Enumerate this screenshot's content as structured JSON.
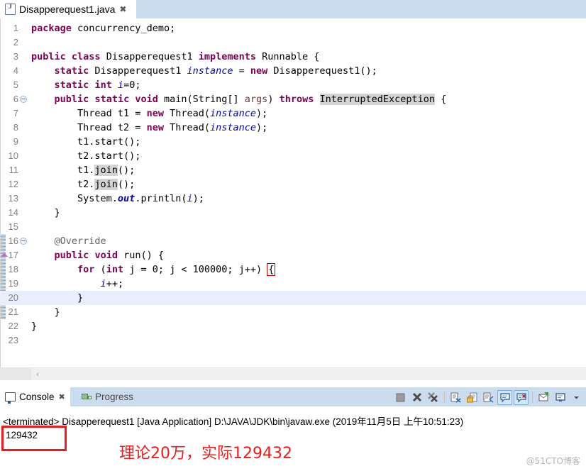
{
  "editor_tab": {
    "label": "Disapperequest1.java",
    "icon": "java-file-icon",
    "close": "✖"
  },
  "code": {
    "lines": [
      {
        "no": "1",
        "indent": 0,
        "tokens": [
          {
            "t": "package",
            "c": "kw"
          },
          {
            "t": " concurrency_demo;",
            "c": ""
          }
        ]
      },
      {
        "no": "2",
        "indent": 0,
        "tokens": []
      },
      {
        "no": "3",
        "indent": 0,
        "tokens": [
          {
            "t": "public",
            "c": "kw"
          },
          {
            "t": " ",
            "c": ""
          },
          {
            "t": "class",
            "c": "kw"
          },
          {
            "t": " Disapperequest1 ",
            "c": ""
          },
          {
            "t": "implements",
            "c": "kw"
          },
          {
            "t": " Runnable {",
            "c": ""
          }
        ]
      },
      {
        "no": "4",
        "indent": 0,
        "tokens": [
          {
            "t": "    ",
            "c": ""
          },
          {
            "t": "static",
            "c": "kw"
          },
          {
            "t": " Disapperequest1 ",
            "c": ""
          },
          {
            "t": "instance",
            "c": "fld"
          },
          {
            "t": " = ",
            "c": ""
          },
          {
            "t": "new",
            "c": "kw"
          },
          {
            "t": " Disapperequest1();",
            "c": ""
          }
        ]
      },
      {
        "no": "5",
        "indent": 0,
        "tokens": [
          {
            "t": "    ",
            "c": ""
          },
          {
            "t": "static",
            "c": "kw"
          },
          {
            "t": " ",
            "c": ""
          },
          {
            "t": "int",
            "c": "kw"
          },
          {
            "t": " ",
            "c": ""
          },
          {
            "t": "i",
            "c": "fld"
          },
          {
            "t": "=0;",
            "c": ""
          }
        ]
      },
      {
        "no": "6",
        "indent": 0,
        "fold": true,
        "tokens": [
          {
            "t": "    ",
            "c": ""
          },
          {
            "t": "public",
            "c": "kw"
          },
          {
            "t": " ",
            "c": ""
          },
          {
            "t": "static",
            "c": "kw"
          },
          {
            "t": " ",
            "c": ""
          },
          {
            "t": "void",
            "c": "kw"
          },
          {
            "t": " main(String[] ",
            "c": ""
          },
          {
            "t": "args",
            "c": "param"
          },
          {
            "t": ") ",
            "c": ""
          },
          {
            "t": "throws",
            "c": "kw"
          },
          {
            "t": " ",
            "c": ""
          },
          {
            "t": "InterruptedException",
            "c": "occ"
          },
          {
            "t": " {",
            "c": ""
          }
        ]
      },
      {
        "no": "7",
        "indent": 0,
        "tokens": [
          {
            "t": "        Thread t1 = ",
            "c": ""
          },
          {
            "t": "new",
            "c": "kw"
          },
          {
            "t": " Thread(",
            "c": ""
          },
          {
            "t": "instance",
            "c": "fld"
          },
          {
            "t": ");",
            "c": ""
          }
        ]
      },
      {
        "no": "8",
        "indent": 0,
        "tokens": [
          {
            "t": "        Thread t2 = ",
            "c": ""
          },
          {
            "t": "new",
            "c": "kw"
          },
          {
            "t": " Thread(",
            "c": ""
          },
          {
            "t": "instance",
            "c": "fld"
          },
          {
            "t": ");",
            "c": ""
          }
        ]
      },
      {
        "no": "9",
        "indent": 0,
        "tokens": [
          {
            "t": "        t1.start();",
            "c": ""
          }
        ]
      },
      {
        "no": "10",
        "indent": 0,
        "tokens": [
          {
            "t": "        t2.start();",
            "c": ""
          }
        ]
      },
      {
        "no": "11",
        "indent": 0,
        "tokens": [
          {
            "t": "        t1.",
            "c": ""
          },
          {
            "t": "join",
            "c": "occ"
          },
          {
            "t": "();",
            "c": ""
          }
        ]
      },
      {
        "no": "12",
        "indent": 0,
        "tokens": [
          {
            "t": "        t2.",
            "c": ""
          },
          {
            "t": "join",
            "c": "occ"
          },
          {
            "t": "();",
            "c": ""
          }
        ]
      },
      {
        "no": "13",
        "indent": 0,
        "tokens": [
          {
            "t": "        System.",
            "c": ""
          },
          {
            "t": "out",
            "c": "sfld"
          },
          {
            "t": ".println(",
            "c": ""
          },
          {
            "t": "i",
            "c": "fld"
          },
          {
            "t": ");",
            "c": ""
          }
        ]
      },
      {
        "no": "14",
        "indent": 0,
        "tokens": [
          {
            "t": "    }",
            "c": ""
          }
        ]
      },
      {
        "no": "15",
        "indent": 0,
        "tokens": []
      },
      {
        "no": "16",
        "indent": 0,
        "fold": true,
        "change": true,
        "tokens": [
          {
            "t": "    ",
            "c": ""
          },
          {
            "t": "@Override",
            "c": "ann"
          }
        ]
      },
      {
        "no": "17",
        "indent": 0,
        "change": true,
        "arrow": true,
        "tokens": [
          {
            "t": "    ",
            "c": ""
          },
          {
            "t": "public",
            "c": "kw"
          },
          {
            "t": " ",
            "c": ""
          },
          {
            "t": "void",
            "c": "kw"
          },
          {
            "t": " run() {",
            "c": ""
          }
        ]
      },
      {
        "no": "18",
        "indent": 0,
        "change": true,
        "tokens": [
          {
            "t": "        ",
            "c": ""
          },
          {
            "t": "for",
            "c": "kw"
          },
          {
            "t": " (",
            "c": ""
          },
          {
            "t": "int",
            "c": "kw"
          },
          {
            "t": " j = 0; j < 100000; j++) ",
            "c": ""
          },
          {
            "t": "{",
            "c": "bracebox"
          }
        ]
      },
      {
        "no": "19",
        "indent": 0,
        "change": true,
        "tokens": [
          {
            "t": "            ",
            "c": ""
          },
          {
            "t": "i",
            "c": "fld"
          },
          {
            "t": "++;",
            "c": ""
          }
        ]
      },
      {
        "no": "20",
        "indent": 0,
        "change": true,
        "current": true,
        "tokens": [
          {
            "t": "        }",
            "c": ""
          }
        ]
      },
      {
        "no": "21",
        "indent": 0,
        "change": true,
        "tokens": [
          {
            "t": "    }",
            "c": ""
          }
        ]
      },
      {
        "no": "22",
        "indent": 0,
        "tokens": [
          {
            "t": "}",
            "c": ""
          }
        ]
      },
      {
        "no": "23",
        "indent": 0,
        "tokens": []
      }
    ]
  },
  "scrollbar": {
    "left_arrow": "‹"
  },
  "console": {
    "tabs": [
      {
        "label": "Console",
        "icon": "console-icon",
        "active": true,
        "close": "✖"
      },
      {
        "label": "Progress",
        "icon": "progress-icon",
        "active": false
      }
    ],
    "toolbar": [
      {
        "name": "terminate-button",
        "glyph": "stop-square-icon",
        "pressed": false
      },
      {
        "name": "remove-launch-button",
        "glyph": "x-icon",
        "pressed": false
      },
      {
        "name": "remove-all-terminated-button",
        "glyph": "double-x-icon",
        "pressed": false
      },
      {
        "name": "separator-1",
        "glyph": "separator",
        "pressed": false
      },
      {
        "name": "clear-console-button",
        "glyph": "clear-console-icon",
        "pressed": false
      },
      {
        "name": "scroll-lock-button",
        "glyph": "lock-icon",
        "pressed": false
      },
      {
        "name": "word-wrap-button",
        "glyph": "wrap-icon",
        "pressed": false
      },
      {
        "name": "show-console-on-output-button",
        "glyph": "console-out-icon",
        "pressed": true
      },
      {
        "name": "show-console-on-error-button",
        "glyph": "console-err-icon",
        "pressed": true
      },
      {
        "name": "separator-2",
        "glyph": "separator",
        "pressed": false
      },
      {
        "name": "pin-console-button",
        "glyph": "pin-icon",
        "pressed": false
      },
      {
        "name": "display-selected-console-button",
        "glyph": "display-console-icon",
        "pressed": false
      },
      {
        "name": "open-console-menu-button",
        "glyph": "chevron-down-icon",
        "pressed": false
      }
    ],
    "status_line": "<terminated> Disapperequest1 [Java Application] D:\\JAVA\\JDK\\bin\\javaw.exe (2019年11月5日 上午10:51:23)",
    "output": "129432"
  },
  "annotation": {
    "text": "理论20万，实际129432",
    "color": "#f01a1a",
    "highlight_box_color": "#ee1c1c"
  },
  "watermark": "@51CTO博客"
}
